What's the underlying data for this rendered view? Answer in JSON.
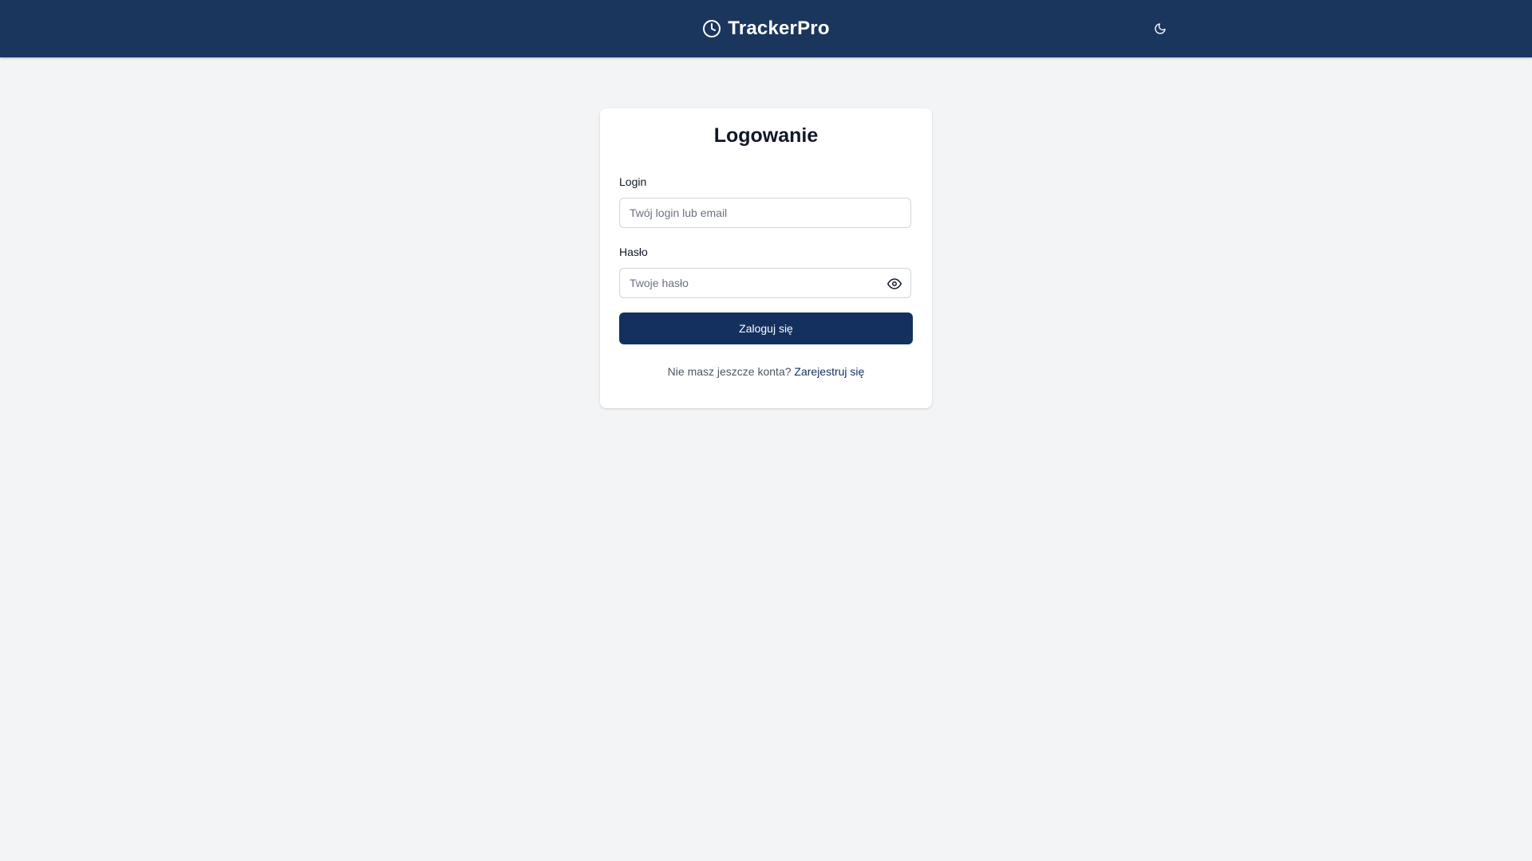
{
  "header": {
    "brand_name": "TrackerPro",
    "brand_icon": "clock-icon",
    "theme_toggle_icon": "moon-icon",
    "background": "#1b365d"
  },
  "login_card": {
    "title": "Logowanie",
    "login_label": "Login",
    "login_placeholder": "Twój login lub email",
    "login_value": "",
    "password_label": "Hasło",
    "password_placeholder": "Twoje hasło",
    "password_value": "",
    "password_toggle_icon": "eye-icon",
    "submit_label": "Zaloguj się",
    "register_prompt": "Nie masz jeszcze konta?",
    "register_link": "Zarejestruj się"
  },
  "colors": {
    "primary": "#14305e",
    "page_background": "#f3f4f6"
  }
}
